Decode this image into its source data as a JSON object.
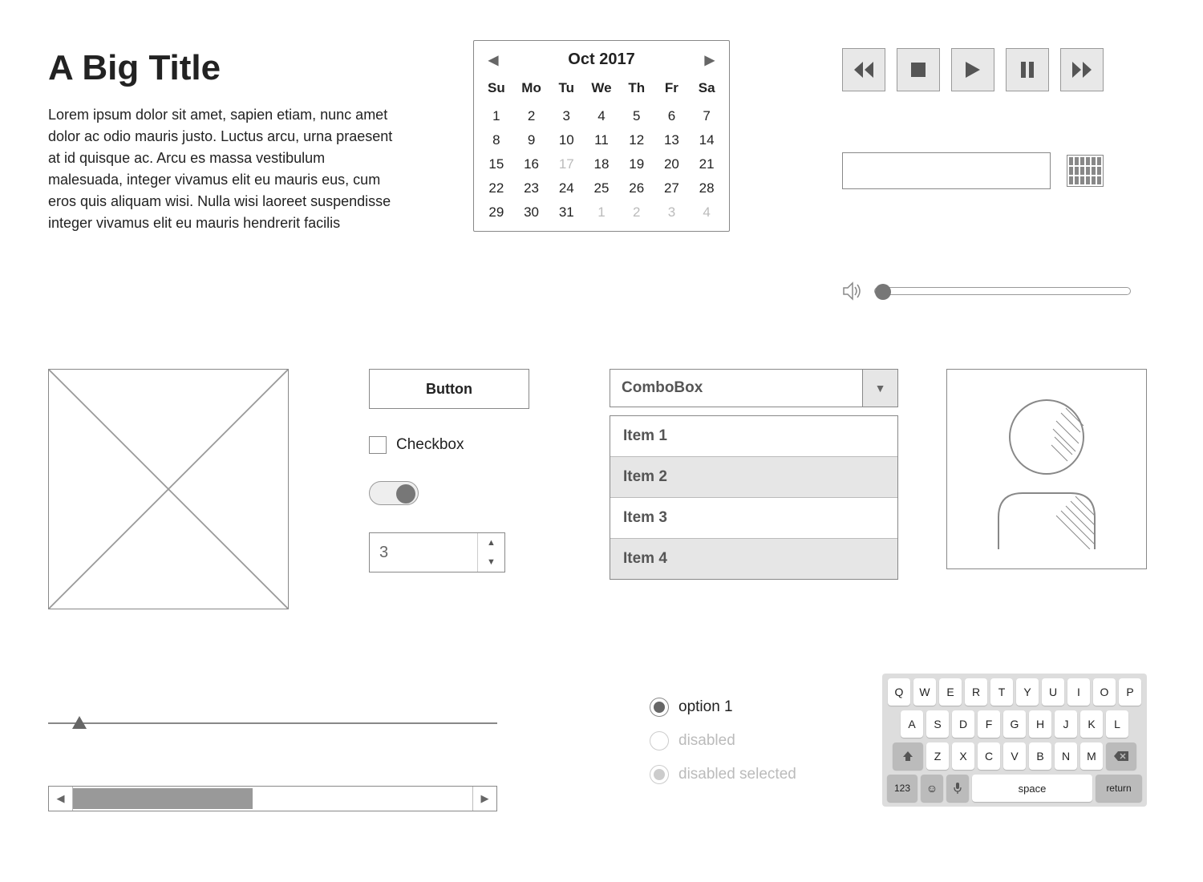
{
  "title": "A Big Title",
  "paragraph": "Lorem ipsum dolor sit amet, sapien etiam, nunc amet dolor ac odio mauris justo. Luctus arcu, urna praesent at id quisque ac. Arcu es massa vestibulum malesuada, integer vivamus elit eu mauris eus, cum eros quis aliquam wisi. Nulla wisi laoreet suspendisse integer vivamus elit eu mauris hendrerit facilis",
  "calendar": {
    "month_label": "Oct 2017",
    "dow": [
      "Su",
      "Mo",
      "Tu",
      "We",
      "Th",
      "Fr",
      "Sa"
    ],
    "days": [
      {
        "n": "1"
      },
      {
        "n": "2"
      },
      {
        "n": "3"
      },
      {
        "n": "4"
      },
      {
        "n": "5"
      },
      {
        "n": "6"
      },
      {
        "n": "7"
      },
      {
        "n": "8"
      },
      {
        "n": "9"
      },
      {
        "n": "10"
      },
      {
        "n": "11"
      },
      {
        "n": "12"
      },
      {
        "n": "13"
      },
      {
        "n": "14"
      },
      {
        "n": "15"
      },
      {
        "n": "16"
      },
      {
        "n": "17",
        "muted": true
      },
      {
        "n": "18"
      },
      {
        "n": "19"
      },
      {
        "n": "20"
      },
      {
        "n": "21"
      },
      {
        "n": "22"
      },
      {
        "n": "23"
      },
      {
        "n": "24"
      },
      {
        "n": "25"
      },
      {
        "n": "26"
      },
      {
        "n": "27"
      },
      {
        "n": "28"
      },
      {
        "n": "29"
      },
      {
        "n": "30"
      },
      {
        "n": "31"
      },
      {
        "n": "1",
        "muted": true
      },
      {
        "n": "2",
        "muted": true
      },
      {
        "n": "3",
        "muted": true
      },
      {
        "n": "4",
        "muted": true
      }
    ]
  },
  "button_label": "Button",
  "checkbox_label": "Checkbox",
  "stepper_value": "3",
  "combo_label": "ComboBox",
  "list_items": [
    "Item 1",
    "Item 2",
    "Item 3",
    "Item 4"
  ],
  "radios": {
    "opt1": "option 1",
    "opt2": "disabled",
    "opt3": "disabled selected"
  },
  "keyboard": {
    "row1": [
      "Q",
      "W",
      "E",
      "R",
      "T",
      "Y",
      "U",
      "I",
      "O",
      "P"
    ],
    "row2": [
      "A",
      "S",
      "D",
      "F",
      "G",
      "H",
      "J",
      "K",
      "L"
    ],
    "row3": [
      "Z",
      "X",
      "C",
      "V",
      "B",
      "N",
      "M"
    ],
    "num_key": "123",
    "space_key": "space",
    "return_key": "return"
  }
}
